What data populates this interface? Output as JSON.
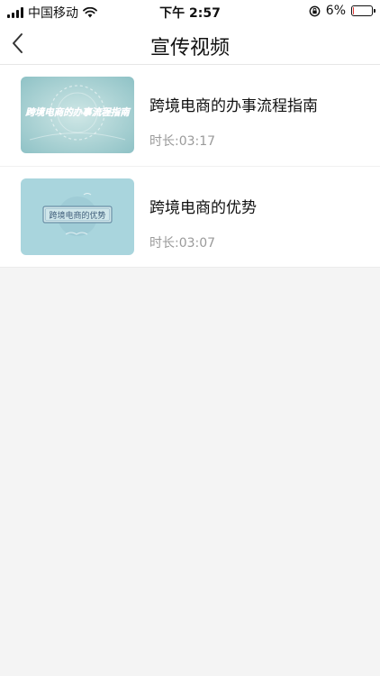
{
  "status_bar": {
    "carrier": "中国移动",
    "time": "下午 2:57",
    "battery_percent": "6%",
    "battery_level": 0.06,
    "battery_color": "#e53935"
  },
  "nav": {
    "title": "宣传视频",
    "back_icon": "chevron-left-icon"
  },
  "videos": [
    {
      "title": "跨境电商的办事流程指南",
      "thumb_text": "跨境电商的办事流程指南",
      "duration_label": "时长:",
      "duration": "03:17"
    },
    {
      "title": "跨境电商的优势",
      "thumb_text": "跨境电商的优势",
      "duration_label": "时长:",
      "duration": "03:07"
    }
  ]
}
